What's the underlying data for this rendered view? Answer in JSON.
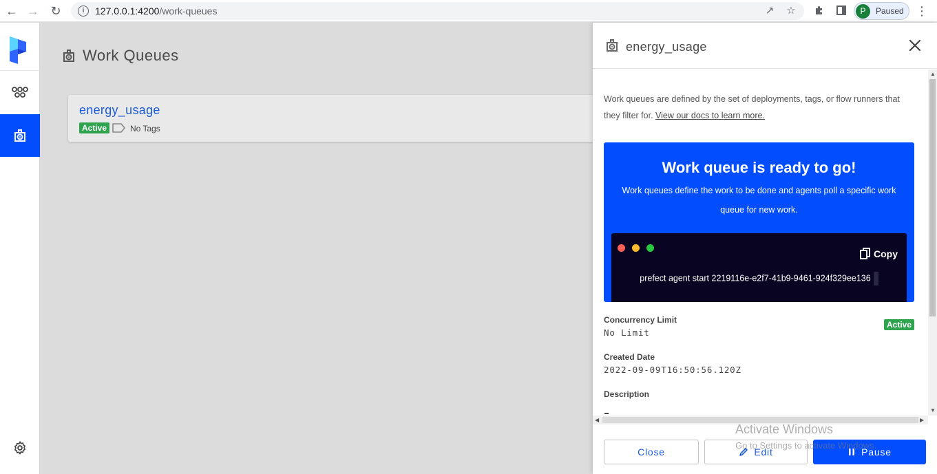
{
  "browser": {
    "url_host": "127.0.0.1:4200",
    "url_path": "/work-queues",
    "profile_initial": "P",
    "profile_status": "Paused"
  },
  "sidebar": {
    "items": [
      {
        "icon": "flows-icon",
        "active": false
      },
      {
        "icon": "work-queue-icon",
        "active": true
      },
      {
        "icon": "gear-icon",
        "active": false
      }
    ]
  },
  "main": {
    "title": "Work Queues",
    "queues": [
      {
        "name": "energy_usage",
        "status": "Active",
        "tags": "No Tags"
      }
    ]
  },
  "drawer": {
    "title": "energy_usage",
    "intro_text": "Work queues are defined by the set of deployments, tags, or flow runners that they filter for.",
    "intro_link": "View our docs to learn more.",
    "ready_title": "Work queue is ready to go!",
    "ready_text": "Work queues define the work to be done and agents poll a specific work queue for new work.",
    "copy_label": "Copy",
    "command": "prefect agent start 2219116e-e2f7-41b9-9461-924f329ee136",
    "concurrency_label": "Concurrency Limit",
    "concurrency_value": "No Limit",
    "status_badge": "Active",
    "created_label": "Created Date",
    "created_value": "2022-09-09T16:50:56.120Z",
    "description_label": "Description",
    "buttons": {
      "close": "Close",
      "edit": "Edit",
      "pause": "Pause"
    }
  },
  "watermark": {
    "line1": "Activate Windows",
    "line2": "Go to Settings to activate Windows."
  },
  "colors": {
    "accent": "#024dfd",
    "active_badge": "#2ea44f",
    "terminal": "#090422",
    "link": "#1c5bd6"
  }
}
